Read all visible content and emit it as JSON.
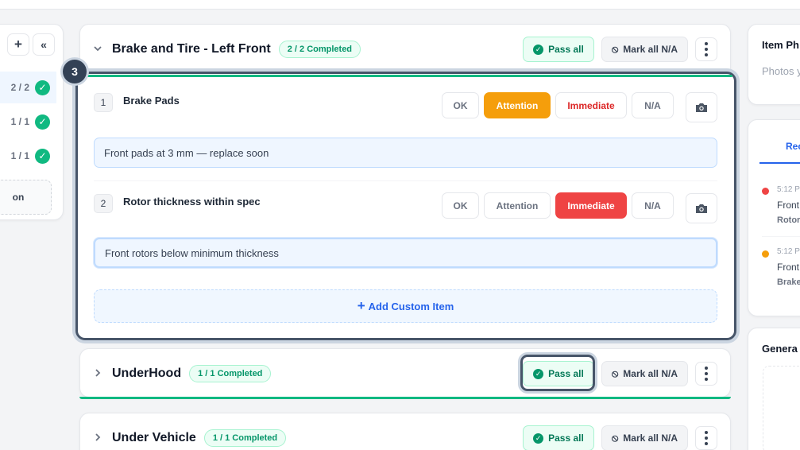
{
  "sidebar": {
    "add_icon": "plus-icon",
    "collapse_icon": "double-chevron-left-icon",
    "rows": [
      {
        "count": "2 / 2",
        "active": true
      },
      {
        "count": "1 / 1",
        "active": false
      },
      {
        "count": "1 / 1",
        "active": false
      }
    ],
    "bottom_text": "on"
  },
  "sections": [
    {
      "title": "Brake and Tire - Left Front",
      "badge": "2 / 2 Completed",
      "chevron": "chevron-down-icon",
      "pass_label": "Pass all",
      "na_label": "Mark all N/A"
    },
    {
      "title": "UnderHood",
      "badge": "1 / 1 Completed",
      "chevron": "chevron-right-icon",
      "pass_label": "Pass all",
      "na_label": "Mark all N/A"
    },
    {
      "title": "Under Vehicle",
      "badge": "1 / 1 Completed",
      "chevron": "chevron-right-icon",
      "pass_label": "Pass all",
      "na_label": "Mark all N/A"
    }
  ],
  "step_badge": "3",
  "items": [
    {
      "number": "1",
      "name": "Brake Pads",
      "options": [
        "OK",
        "Attention",
        "Immediate",
        "N/A"
      ],
      "selected": "Attention",
      "note": "Front pads at 3 mm — replace soon"
    },
    {
      "number": "2",
      "name": "Rotor thickness within spec",
      "options": [
        "OK",
        "Attention",
        "Immediate",
        "N/A"
      ],
      "selected": "Immediate",
      "note": "Front rotors below minimum thickness"
    }
  ],
  "add_custom_label": "Add Custom Item",
  "right": {
    "photos_title": "Item Ph",
    "photos_sub": "Photos y",
    "tab_label": "Rec",
    "activity": [
      {
        "time": "5:12 Pl",
        "line1": "Front",
        "line2": "Rotor",
        "color": "#ef4444"
      },
      {
        "time": "5:12 Pl",
        "line1": "Front",
        "line2": "Brake",
        "color": "#f59e0b"
      }
    ],
    "general_title": "Genera"
  },
  "colors": {
    "accent_green": "#10b981",
    "attention": "#f59e0b",
    "immediate": "#ef4444",
    "link_blue": "#2563eb"
  }
}
